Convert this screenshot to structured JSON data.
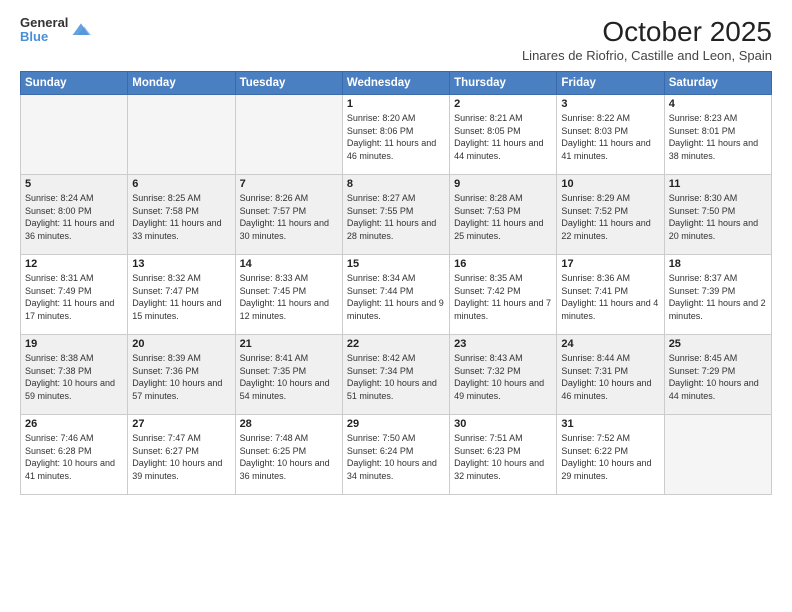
{
  "header": {
    "logo_line1": "General",
    "logo_line2": "Blue",
    "title": "October 2025",
    "subtitle": "Linares de Riofrio, Castille and Leon, Spain"
  },
  "days_of_week": [
    "Sunday",
    "Monday",
    "Tuesday",
    "Wednesday",
    "Thursday",
    "Friday",
    "Saturday"
  ],
  "weeks": [
    [
      {
        "day": "",
        "sunrise": "",
        "sunset": "",
        "daylight": ""
      },
      {
        "day": "",
        "sunrise": "",
        "sunset": "",
        "daylight": ""
      },
      {
        "day": "",
        "sunrise": "",
        "sunset": "",
        "daylight": ""
      },
      {
        "day": "1",
        "sunrise": "Sunrise: 8:20 AM",
        "sunset": "Sunset: 8:06 PM",
        "daylight": "Daylight: 11 hours and 46 minutes."
      },
      {
        "day": "2",
        "sunrise": "Sunrise: 8:21 AM",
        "sunset": "Sunset: 8:05 PM",
        "daylight": "Daylight: 11 hours and 44 minutes."
      },
      {
        "day": "3",
        "sunrise": "Sunrise: 8:22 AM",
        "sunset": "Sunset: 8:03 PM",
        "daylight": "Daylight: 11 hours and 41 minutes."
      },
      {
        "day": "4",
        "sunrise": "Sunrise: 8:23 AM",
        "sunset": "Sunset: 8:01 PM",
        "daylight": "Daylight: 11 hours and 38 minutes."
      }
    ],
    [
      {
        "day": "5",
        "sunrise": "Sunrise: 8:24 AM",
        "sunset": "Sunset: 8:00 PM",
        "daylight": "Daylight: 11 hours and 36 minutes."
      },
      {
        "day": "6",
        "sunrise": "Sunrise: 8:25 AM",
        "sunset": "Sunset: 7:58 PM",
        "daylight": "Daylight: 11 hours and 33 minutes."
      },
      {
        "day": "7",
        "sunrise": "Sunrise: 8:26 AM",
        "sunset": "Sunset: 7:57 PM",
        "daylight": "Daylight: 11 hours and 30 minutes."
      },
      {
        "day": "8",
        "sunrise": "Sunrise: 8:27 AM",
        "sunset": "Sunset: 7:55 PM",
        "daylight": "Daylight: 11 hours and 28 minutes."
      },
      {
        "day": "9",
        "sunrise": "Sunrise: 8:28 AM",
        "sunset": "Sunset: 7:53 PM",
        "daylight": "Daylight: 11 hours and 25 minutes."
      },
      {
        "day": "10",
        "sunrise": "Sunrise: 8:29 AM",
        "sunset": "Sunset: 7:52 PM",
        "daylight": "Daylight: 11 hours and 22 minutes."
      },
      {
        "day": "11",
        "sunrise": "Sunrise: 8:30 AM",
        "sunset": "Sunset: 7:50 PM",
        "daylight": "Daylight: 11 hours and 20 minutes."
      }
    ],
    [
      {
        "day": "12",
        "sunrise": "Sunrise: 8:31 AM",
        "sunset": "Sunset: 7:49 PM",
        "daylight": "Daylight: 11 hours and 17 minutes."
      },
      {
        "day": "13",
        "sunrise": "Sunrise: 8:32 AM",
        "sunset": "Sunset: 7:47 PM",
        "daylight": "Daylight: 11 hours and 15 minutes."
      },
      {
        "day": "14",
        "sunrise": "Sunrise: 8:33 AM",
        "sunset": "Sunset: 7:45 PM",
        "daylight": "Daylight: 11 hours and 12 minutes."
      },
      {
        "day": "15",
        "sunrise": "Sunrise: 8:34 AM",
        "sunset": "Sunset: 7:44 PM",
        "daylight": "Daylight: 11 hours and 9 minutes."
      },
      {
        "day": "16",
        "sunrise": "Sunrise: 8:35 AM",
        "sunset": "Sunset: 7:42 PM",
        "daylight": "Daylight: 11 hours and 7 minutes."
      },
      {
        "day": "17",
        "sunrise": "Sunrise: 8:36 AM",
        "sunset": "Sunset: 7:41 PM",
        "daylight": "Daylight: 11 hours and 4 minutes."
      },
      {
        "day": "18",
        "sunrise": "Sunrise: 8:37 AM",
        "sunset": "Sunset: 7:39 PM",
        "daylight": "Daylight: 11 hours and 2 minutes."
      }
    ],
    [
      {
        "day": "19",
        "sunrise": "Sunrise: 8:38 AM",
        "sunset": "Sunset: 7:38 PM",
        "daylight": "Daylight: 10 hours and 59 minutes."
      },
      {
        "day": "20",
        "sunrise": "Sunrise: 8:39 AM",
        "sunset": "Sunset: 7:36 PM",
        "daylight": "Daylight: 10 hours and 57 minutes."
      },
      {
        "day": "21",
        "sunrise": "Sunrise: 8:41 AM",
        "sunset": "Sunset: 7:35 PM",
        "daylight": "Daylight: 10 hours and 54 minutes."
      },
      {
        "day": "22",
        "sunrise": "Sunrise: 8:42 AM",
        "sunset": "Sunset: 7:34 PM",
        "daylight": "Daylight: 10 hours and 51 minutes."
      },
      {
        "day": "23",
        "sunrise": "Sunrise: 8:43 AM",
        "sunset": "Sunset: 7:32 PM",
        "daylight": "Daylight: 10 hours and 49 minutes."
      },
      {
        "day": "24",
        "sunrise": "Sunrise: 8:44 AM",
        "sunset": "Sunset: 7:31 PM",
        "daylight": "Daylight: 10 hours and 46 minutes."
      },
      {
        "day": "25",
        "sunrise": "Sunrise: 8:45 AM",
        "sunset": "Sunset: 7:29 PM",
        "daylight": "Daylight: 10 hours and 44 minutes."
      }
    ],
    [
      {
        "day": "26",
        "sunrise": "Sunrise: 7:46 AM",
        "sunset": "Sunset: 6:28 PM",
        "daylight": "Daylight: 10 hours and 41 minutes."
      },
      {
        "day": "27",
        "sunrise": "Sunrise: 7:47 AM",
        "sunset": "Sunset: 6:27 PM",
        "daylight": "Daylight: 10 hours and 39 minutes."
      },
      {
        "day": "28",
        "sunrise": "Sunrise: 7:48 AM",
        "sunset": "Sunset: 6:25 PM",
        "daylight": "Daylight: 10 hours and 36 minutes."
      },
      {
        "day": "29",
        "sunrise": "Sunrise: 7:50 AM",
        "sunset": "Sunset: 6:24 PM",
        "daylight": "Daylight: 10 hours and 34 minutes."
      },
      {
        "day": "30",
        "sunrise": "Sunrise: 7:51 AM",
        "sunset": "Sunset: 6:23 PM",
        "daylight": "Daylight: 10 hours and 32 minutes."
      },
      {
        "day": "31",
        "sunrise": "Sunrise: 7:52 AM",
        "sunset": "Sunset: 6:22 PM",
        "daylight": "Daylight: 10 hours and 29 minutes."
      },
      {
        "day": "",
        "sunrise": "",
        "sunset": "",
        "daylight": ""
      }
    ]
  ]
}
